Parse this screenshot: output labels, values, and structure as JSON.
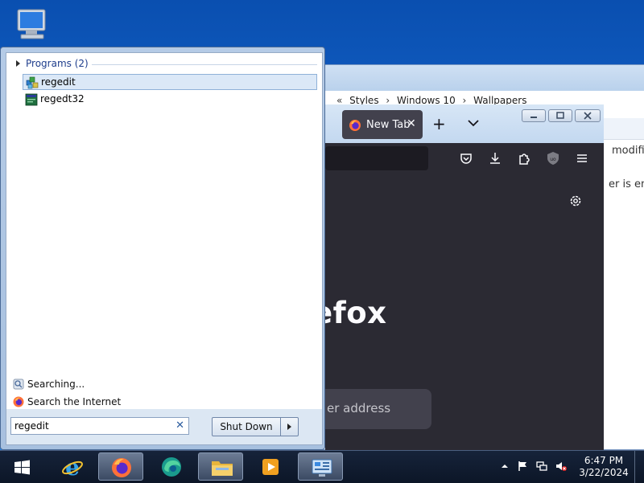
{
  "explorer": {
    "breadcrumb": [
      "Styles",
      "Windows 10",
      "Wallpapers"
    ],
    "right_text_1": "modifie",
    "right_text_2": "er is em"
  },
  "firefox": {
    "tab_label": "New Tab",
    "brand_text": "efox",
    "search_placeholder": "er address"
  },
  "start_menu": {
    "group_header": "Programs (2)",
    "results": [
      {
        "label": "regedit",
        "selected": true
      },
      {
        "label": "regedt32",
        "selected": false
      }
    ],
    "searching_label": "Searching...",
    "internet_label": "Search the Internet",
    "search_value": "regedit",
    "shutdown_label": "Shut Down"
  },
  "taskbar": {
    "pinned": [
      "internet-explorer-icon",
      "firefox-icon",
      "edge-icon",
      "file-explorer-icon",
      "media-player-icon",
      "control-panel-icon"
    ],
    "time": "6:47 PM",
    "date": "3/22/2024"
  },
  "colors": {
    "desktop_top": "#0a4fb0",
    "firefox_dark": "#2b2a33",
    "selection": "#dbe8f7",
    "header_blue": "#1e3d8c"
  }
}
